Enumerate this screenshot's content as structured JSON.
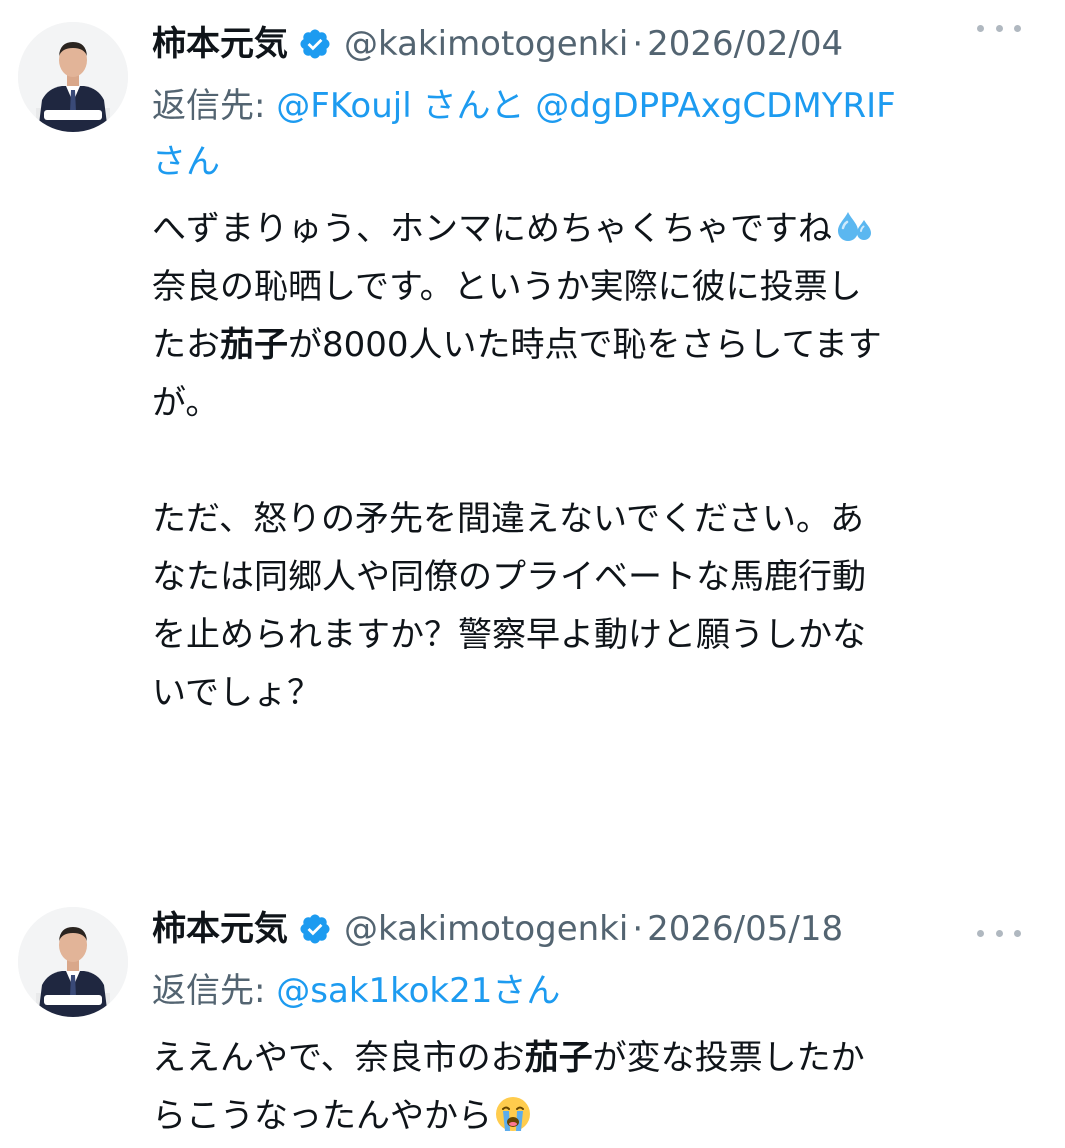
{
  "tweets": [
    {
      "display_name": "柿本元気",
      "handle": "@kakimotogenki",
      "separator": "·",
      "date": "2026/02/04",
      "reply_prefix": "返信先: ",
      "reply_mentions": [
        "@FKoujl",
        "@dgDPPAxgCDMYRIF"
      ],
      "reply_connector": " さんと ",
      "reply_suffix_line2": "さん",
      "paragraph_1": {
        "line_1": "へずまりゅう、ホンマにめちゃくちゃですね",
        "line_1_emoji": "sweat-droplets-icon",
        "line_2": "奈良の恥晒しです。というか実際に彼に投票し",
        "line_3_a": "たお",
        "line_3_bold": "茄子",
        "line_3_b": "が8000人いた時点で恥をさらしてます",
        "line_4": "が。"
      },
      "paragraph_2": {
        "line_1": "ただ、怒りの矛先を間違えないでください。あ",
        "line_2": "なたは同郷人や同僚のプライベートな馬鹿行動",
        "line_3": "を止められますか？警察早よ動けと願うしかな",
        "line_4": "いでしょ？"
      }
    },
    {
      "display_name": "柿本元気",
      "handle": "@kakimotogenki",
      "separator": "·",
      "date": "2026/05/18",
      "reply_prefix": "返信先: ",
      "reply_mention": "@sak1kok21",
      "reply_suffix": "さん",
      "line_1_a": "ええんやで、奈良市のお",
      "line_1_bold": "茄子",
      "line_1_b": "が変な投票したか",
      "line_2": "らこうなったんやから",
      "line_2_emoji": "crying-face-icon"
    }
  ],
  "colors": {
    "text": "#0f1419",
    "secondary": "#536471",
    "link": "#1d9bf0",
    "verified": "#1d9bf0"
  }
}
